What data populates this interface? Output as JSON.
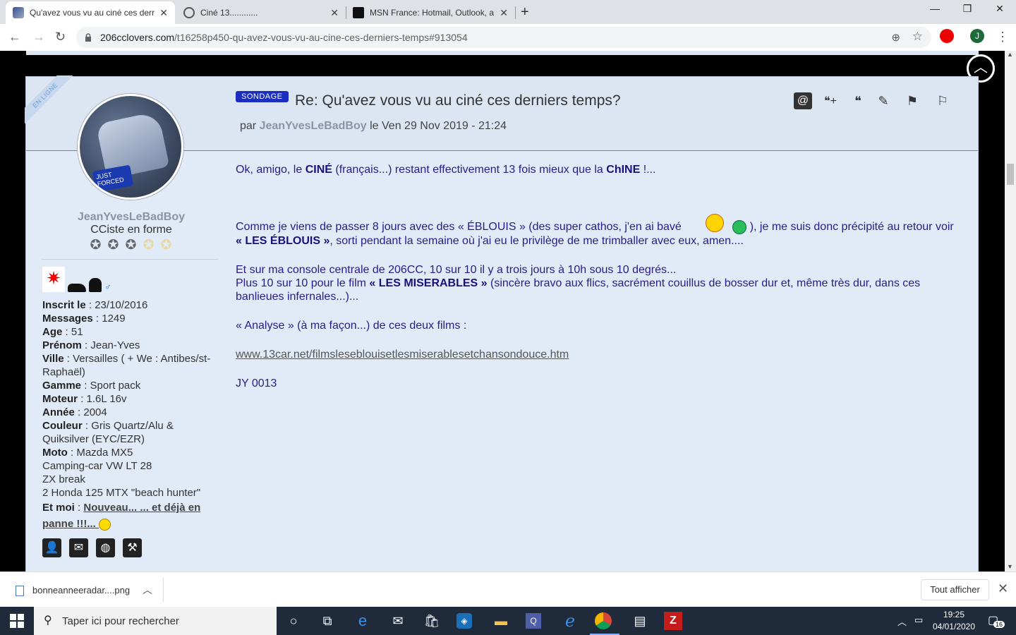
{
  "browser": {
    "tabs": [
      {
        "title": "Qu'avez vous vu au ciné ces derr",
        "active": true
      },
      {
        "title": "Ciné 13............",
        "active": false
      },
      {
        "title": "MSN France: Hotmail, Outlook, a",
        "active": false
      }
    ],
    "new_tab": "+",
    "close_tab": "✕",
    "window_min": "—",
    "window_max": "❐",
    "window_close": "✕",
    "url_host": "206cclovers.com",
    "url_path": "/t16258p450-qu-avez-vous-vu-au-cine-ces-derniers-temps#913054",
    "profile_initial": "J"
  },
  "post": {
    "online_ribbon": "EN LIGNE",
    "badge": "SONDAGE",
    "title": "Re: Qu'avez vous vu au ciné ces derniers temps?",
    "by_prefix": "par",
    "author": "JeanYvesLeBadBoy",
    "date": "le Ven 29 Nov 2019 - 21:24",
    "action_icons": [
      "mention-icon",
      "multi-quote-icon",
      "quote-icon",
      "edit-icon",
      "report-flag-icon",
      "warn-icon"
    ]
  },
  "user": {
    "name": "JeanYvesLeBadBoy",
    "rank": "CCiste en forme",
    "avatar_plate": "JUST FORCED",
    "stars": 5,
    "stars_filled": 3,
    "profile": [
      {
        "label": "Inscrit le",
        "value": "23/10/2016"
      },
      {
        "label": "Messages",
        "value": "1249"
      },
      {
        "label": "Age",
        "value": "51"
      },
      {
        "label": "Prénom",
        "value": "Jean-Yves"
      },
      {
        "label": "Ville",
        "value": "Versailles ( + We : Antibes/st-Raphaël)"
      },
      {
        "label": "Gamme",
        "value": "Sport pack"
      },
      {
        "label": "Moteur",
        "value": "1.6L 16v"
      },
      {
        "label": "Année",
        "value": "2004"
      },
      {
        "label": "Couleur",
        "value": "Gris Quartz/Alu & Quiksilver (EYC/EZR)"
      },
      {
        "label": "Moto",
        "value": "Mazda MX5"
      }
    ],
    "extra_lines": [
      "Camping-car VW LT 28",
      "ZX break",
      "2 Honda 125 MTX \"beach hunter\""
    ],
    "et_moi_label": "Et moi",
    "et_moi_link": "Nouveau... ... et déjà en panne !!!... "
  },
  "content": {
    "p1_a": "Ok, amigo, le ",
    "p1_b": "CINÉ",
    "p1_c": " (français...) restant effectivement 13 fois mieux que la ",
    "p1_d": "ChINE",
    "p1_e": " !...",
    "p2_a": "Comme je viens de passer 8 jours avec des « ÉBLOUIS » (des super cathos, j'en ai bavé ",
    "p2_b": " ), je me suis donc précipité au retour voir ",
    "p2_c": "« LES ÉBLOUIS »",
    "p2_d": ", sorti pendant la semaine où j'ai eu le privilège de me trimballer avec eux, amen....",
    "p3_a": "Et sur ma console centrale de 206CC, 10 sur 10 il y a trois jours à 10h sous 10 degrés...",
    "p3_b": "Plus 10 sur 10 pour le film ",
    "p3_c": "« LES MISERABLES »",
    "p3_d": "  (sincère bravo aux flics, sacrément couillus de bosser dur et, même très dur, dans ces banlieues infernales...)...",
    "p4": "« Analyse » (à ma façon...) de ces deux films :",
    "link": "www.13car.net/filmsleseblouisetlesmiserablesetchansondouce.htm",
    "sig": "JY 0013"
  },
  "download": {
    "file": "bonneanneeradar....png",
    "show_all": "Tout afficher"
  },
  "taskbar": {
    "search_placeholder": "Taper ici pour rechercher",
    "time": "19:25",
    "date": "04/01/2020",
    "notif_count": "16"
  }
}
